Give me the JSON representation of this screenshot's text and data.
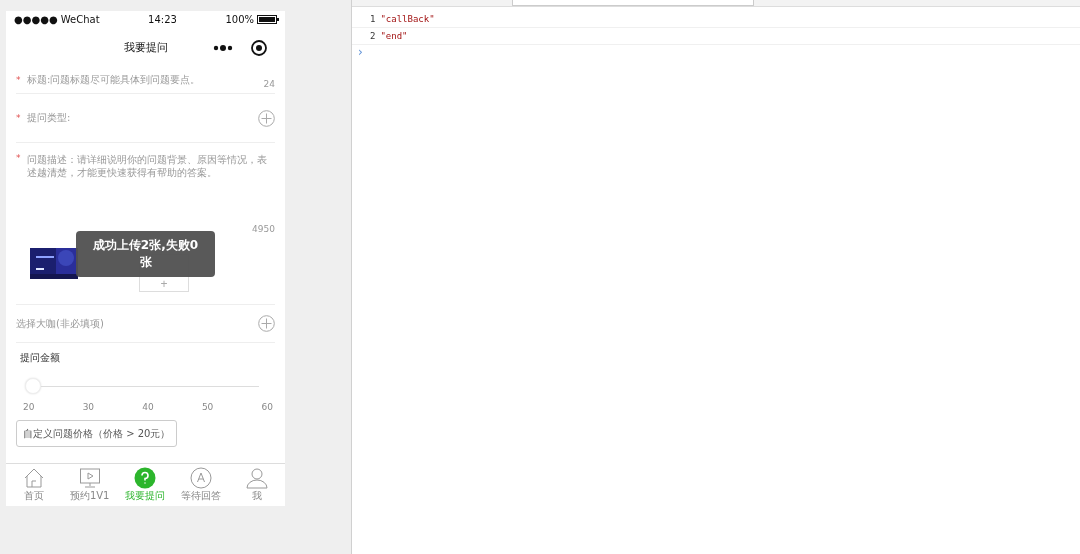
{
  "status_bar": {
    "carrier": "●●●●● WeChat",
    "time": "14:23",
    "battery": "100%"
  },
  "nav": {
    "title": "我要提问"
  },
  "form": {
    "title_field": {
      "mark": "*",
      "placeholder": "标题:问题标题尽可能具体到问题要点。",
      "counter": "24"
    },
    "type_field": {
      "mark": "*",
      "label": "提问类型:"
    },
    "description": {
      "mark": "*",
      "placeholder": "问题描述：请详细说明你的问题背景、原因等情况，表述越清楚，才能更快速获得有帮助的答案。",
      "counter": "4950",
      "add": "+"
    },
    "expert": {
      "label": "选择大咖(非必填项)"
    },
    "amount": {
      "label": "提问金额",
      "level": 0,
      "ticks": [
        "20",
        "30",
        "40",
        "50",
        "60"
      ]
    },
    "custom_price": "自定义问题价格（价格 > 20元）"
  },
  "toast": "成功上传2张,失败0张",
  "tabs": [
    {
      "label": "首页",
      "kind": "home",
      "selected": false
    },
    {
      "label": "预约1V1",
      "kind": "screen",
      "selected": false
    },
    {
      "label": "我要提问",
      "kind": "question",
      "selected": true
    },
    {
      "label": "等待回答",
      "kind": "answer",
      "selected": false
    },
    {
      "label": "我",
      "kind": "me",
      "selected": false
    }
  ],
  "console": {
    "lines": [
      {
        "num": "1",
        "text": "\"callBack\""
      },
      {
        "num": "2",
        "text": "\"end\""
      }
    ],
    "prompt": "›"
  }
}
